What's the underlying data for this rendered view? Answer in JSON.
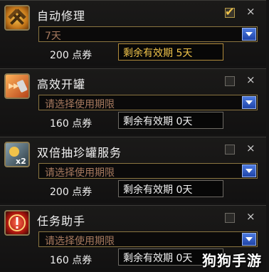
{
  "items": [
    {
      "title": "自动修理",
      "checked": true,
      "select_value": "7天",
      "price": "200",
      "price_unit": "点券",
      "remaining_label": "剩余有效期",
      "remaining_value": "5天",
      "icon": "repair-hammer-icon"
    },
    {
      "title": "高效开罐",
      "checked": false,
      "select_value": "请选择使用期限",
      "price": "160",
      "price_unit": "点券",
      "remaining_label": "剩余有效期",
      "remaining_value": "0天",
      "icon": "fast-open-can-icon"
    },
    {
      "title": "双倍抽珍罐服务",
      "checked": false,
      "select_value": "请选择使用期限",
      "price": "200",
      "price_unit": "点券",
      "remaining_label": "剩余有效期",
      "remaining_value": "0天",
      "icon": "double-x2-icon"
    },
    {
      "title": "任务助手",
      "checked": false,
      "select_value": "请选择使用期限",
      "price": "160",
      "price_unit": "点券",
      "remaining_label": "剩余有效期",
      "remaining_value": "0天",
      "icon": "task-assistant-icon"
    }
  ],
  "close_glyph": "×",
  "watermark": "狗狗手游",
  "colors": {
    "accent_gold": "#f0c34a",
    "dropdown_blue": "#2d58c7"
  }
}
